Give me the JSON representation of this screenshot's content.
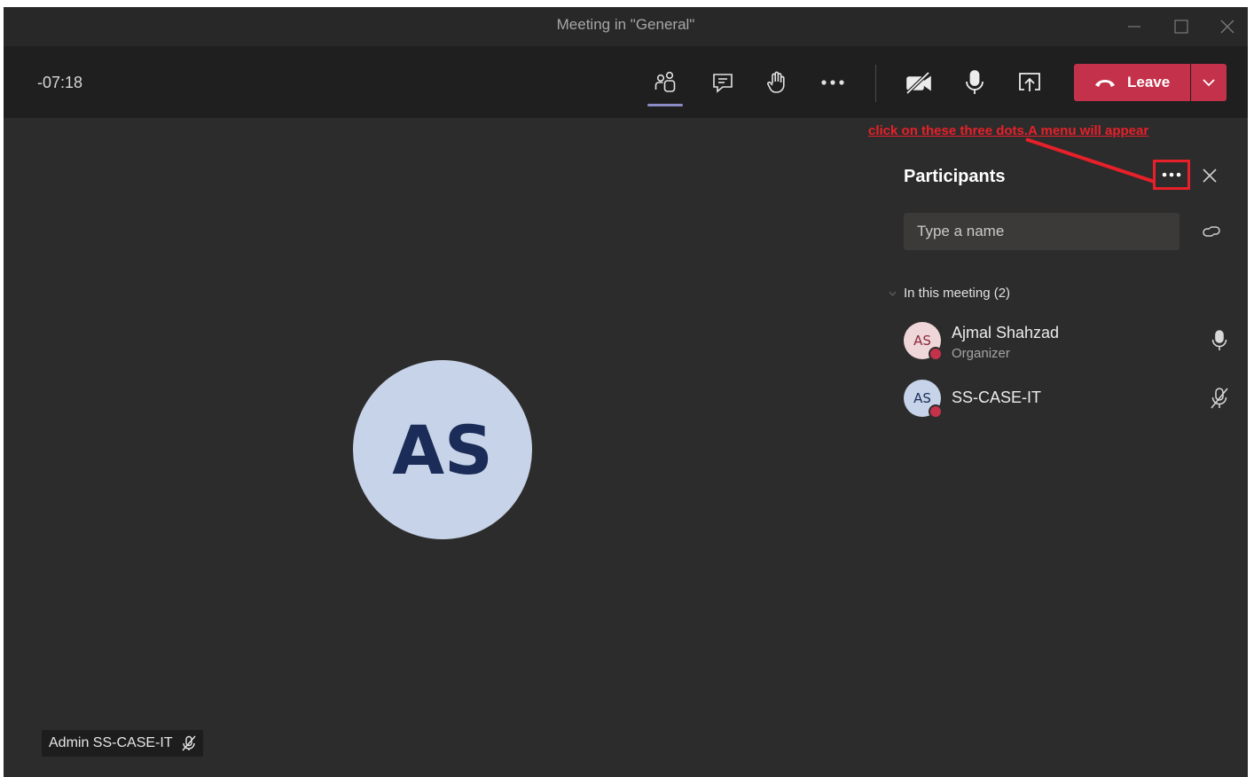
{
  "window": {
    "title": "Meeting in \"General\""
  },
  "toolbar": {
    "timer": "-07:18",
    "buttons": [
      "people-icon",
      "chat-icon",
      "raise-hand-icon",
      "more-options-icon",
      "camera-off-icon",
      "microphone-icon",
      "share-screen-icon"
    ],
    "leave_label": "Leave"
  },
  "annotation": {
    "text": "click on these three dots.A menu will appear",
    "color": "#e8202a"
  },
  "panel": {
    "title": "Participants",
    "search_placeholder": "Type a name",
    "section_label": "In this meeting (2)",
    "participants": [
      {
        "initials": "AS",
        "name": "Ajmal Shahzad",
        "role": "Organizer",
        "mic": "microphone-icon",
        "avatar_bg": "#efd6d9",
        "avatar_fg": "#8a2a3a"
      },
      {
        "initials": "AS",
        "name": "SS-CASE-IT",
        "role": "",
        "mic": "microphone-off-icon",
        "avatar_bg": "#c7d3e8",
        "avatar_fg": "#1a2c57"
      }
    ]
  },
  "stage": {
    "avatar_initials": "AS",
    "name_tag": "Admin SS-CASE-IT"
  },
  "colors": {
    "leave": "#c4314b",
    "active_underline": "#8b8cc7",
    "background": "#2d2c2c"
  }
}
